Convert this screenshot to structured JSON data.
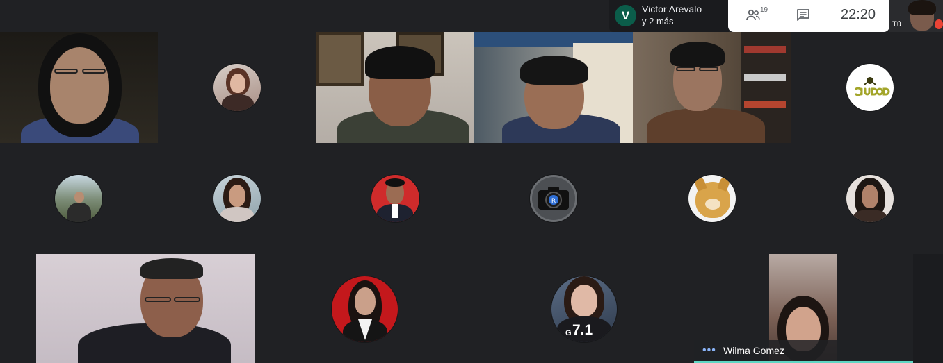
{
  "presenter": {
    "initial": "V",
    "name": "Victor Arevalo",
    "more": "y 2 más"
  },
  "controls": {
    "people_count": "19",
    "time": "22:20",
    "people_icon": "people-icon",
    "chat_icon": "chat-icon"
  },
  "self_view": {
    "label": "Tú",
    "mic_icon": "mic-off-icon"
  },
  "active_speaker": {
    "name": "Wilma Gomez",
    "indicator": "•••"
  },
  "avatar_overlay": {
    "prefix": "G",
    "number": "7.1"
  },
  "colors": {
    "background": "#202124",
    "presenter_avatar": "#0b5d4a",
    "speaking_accent": "#5fd6c4",
    "mic_muted": "#ea4335"
  }
}
